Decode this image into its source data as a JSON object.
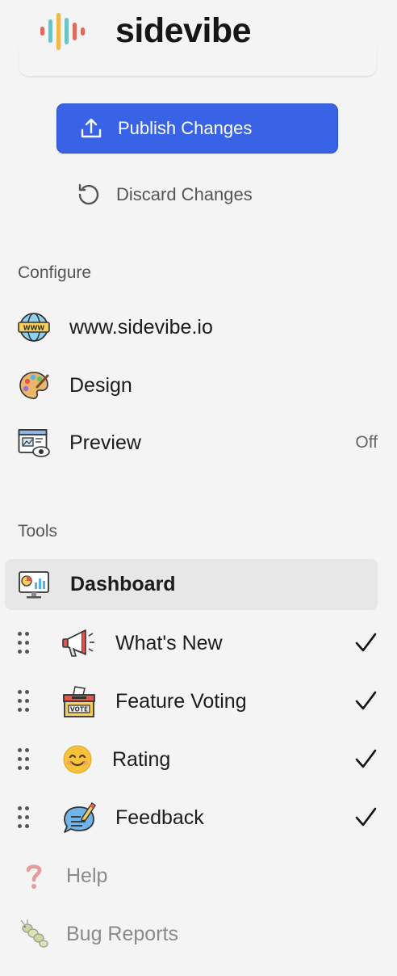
{
  "header": {
    "brand": "sidevibe"
  },
  "actions": {
    "publish_label": "Publish Changes",
    "discard_label": "Discard Changes"
  },
  "configure": {
    "title": "Configure",
    "items": [
      {
        "label": "www.sidevibe.io",
        "icon": "globe-www-icon"
      },
      {
        "label": "Design",
        "icon": "palette-icon"
      },
      {
        "label": "Preview",
        "icon": "preview-window-icon",
        "value": "Off"
      }
    ]
  },
  "tools": {
    "title": "Tools",
    "dashboard": {
      "label": "Dashboard",
      "icon": "dashboard-monitor-icon"
    },
    "items": [
      {
        "label": "What's New",
        "icon": "megaphone-icon",
        "emoji": "📢",
        "enabled": true
      },
      {
        "label": "Feature Voting",
        "icon": "vote-box-icon",
        "emoji": "🗳",
        "enabled": true
      },
      {
        "label": "Rating",
        "icon": "smiley-icon",
        "emoji": "😊",
        "enabled": true
      },
      {
        "label": "Feedback",
        "icon": "feedback-bubble-icon",
        "emoji": "💬",
        "enabled": true
      }
    ],
    "extras": [
      {
        "label": "Help",
        "icon": "question-mark-icon",
        "emoji": "❓"
      },
      {
        "label": "Bug Reports",
        "icon": "bug-icon",
        "emoji": "🐛"
      }
    ]
  },
  "colors": {
    "accent": "#3863e6",
    "background": "#f4f4f4",
    "selected_row": "#e7e7e7"
  }
}
